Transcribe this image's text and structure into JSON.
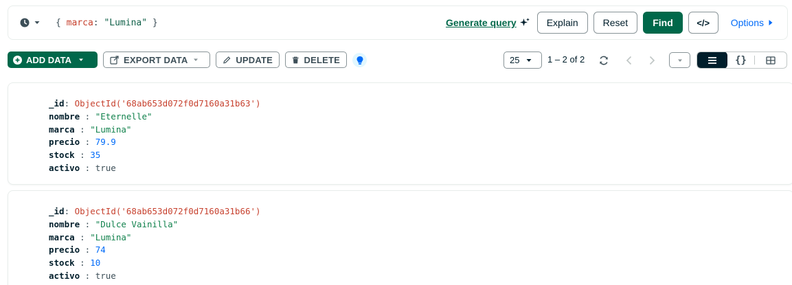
{
  "query_bar": {
    "filter": {
      "open": "{ ",
      "key": "marca",
      "colon": ": ",
      "value": "\"Lumina\"",
      "close": " }"
    },
    "generate_query_label": "Generate query",
    "explain_label": "Explain",
    "reset_label": "Reset",
    "find_label": "Find",
    "code_label": "</>",
    "options_label": "Options"
  },
  "toolbar": {
    "add_data_label": "ADD DATA",
    "export_data_label": "EXPORT DATA",
    "update_label": "UPDATE",
    "delete_label": "DELETE",
    "page_size": "25",
    "range_text": "1 – 2 of 2",
    "view_json_label": "{}"
  },
  "documents": [
    {
      "fields": [
        {
          "key": "_id",
          "value": "ObjectId('68ab653d072f0d7160a31b63')",
          "type": "oid"
        },
        {
          "key": "nombre",
          "value": "\"Eternelle\"",
          "type": "str"
        },
        {
          "key": "marca",
          "value": "\"Lumina\"",
          "type": "str"
        },
        {
          "key": "precio",
          "value": "79.9",
          "type": "num"
        },
        {
          "key": "stock",
          "value": "35",
          "type": "num"
        },
        {
          "key": "activo",
          "value": "true",
          "type": "bool"
        }
      ]
    },
    {
      "fields": [
        {
          "key": "_id",
          "value": "ObjectId('68ab653d072f0d7160a31b66')",
          "type": "oid"
        },
        {
          "key": "nombre",
          "value": "\"Dulce Vainilla\"",
          "type": "str"
        },
        {
          "key": "marca",
          "value": "\"Lumina\"",
          "type": "str"
        },
        {
          "key": "precio",
          "value": "74",
          "type": "num"
        },
        {
          "key": "stock",
          "value": "10",
          "type": "num"
        },
        {
          "key": "activo",
          "value": "true",
          "type": "bool"
        }
      ]
    }
  ],
  "colors": {
    "brand_green": "#00684a",
    "object_id": "#c7422f",
    "string": "#12824d",
    "number": "#016bf8",
    "link_blue": "#016bf8",
    "dark": "#001e2b"
  },
  "icons": {
    "history": "clock-icon",
    "generate": "sparkle-icon",
    "options": "caret-right-icon",
    "add": "plus-circle-icon",
    "export": "export-icon",
    "update": "pencil-icon",
    "delete": "trash-icon",
    "tip": "lightbulb-icon",
    "refresh": "refresh-icon",
    "prev": "chevron-left-icon",
    "next": "chevron-right-icon",
    "list_view": "list-icon",
    "table_view": "table-icon"
  }
}
